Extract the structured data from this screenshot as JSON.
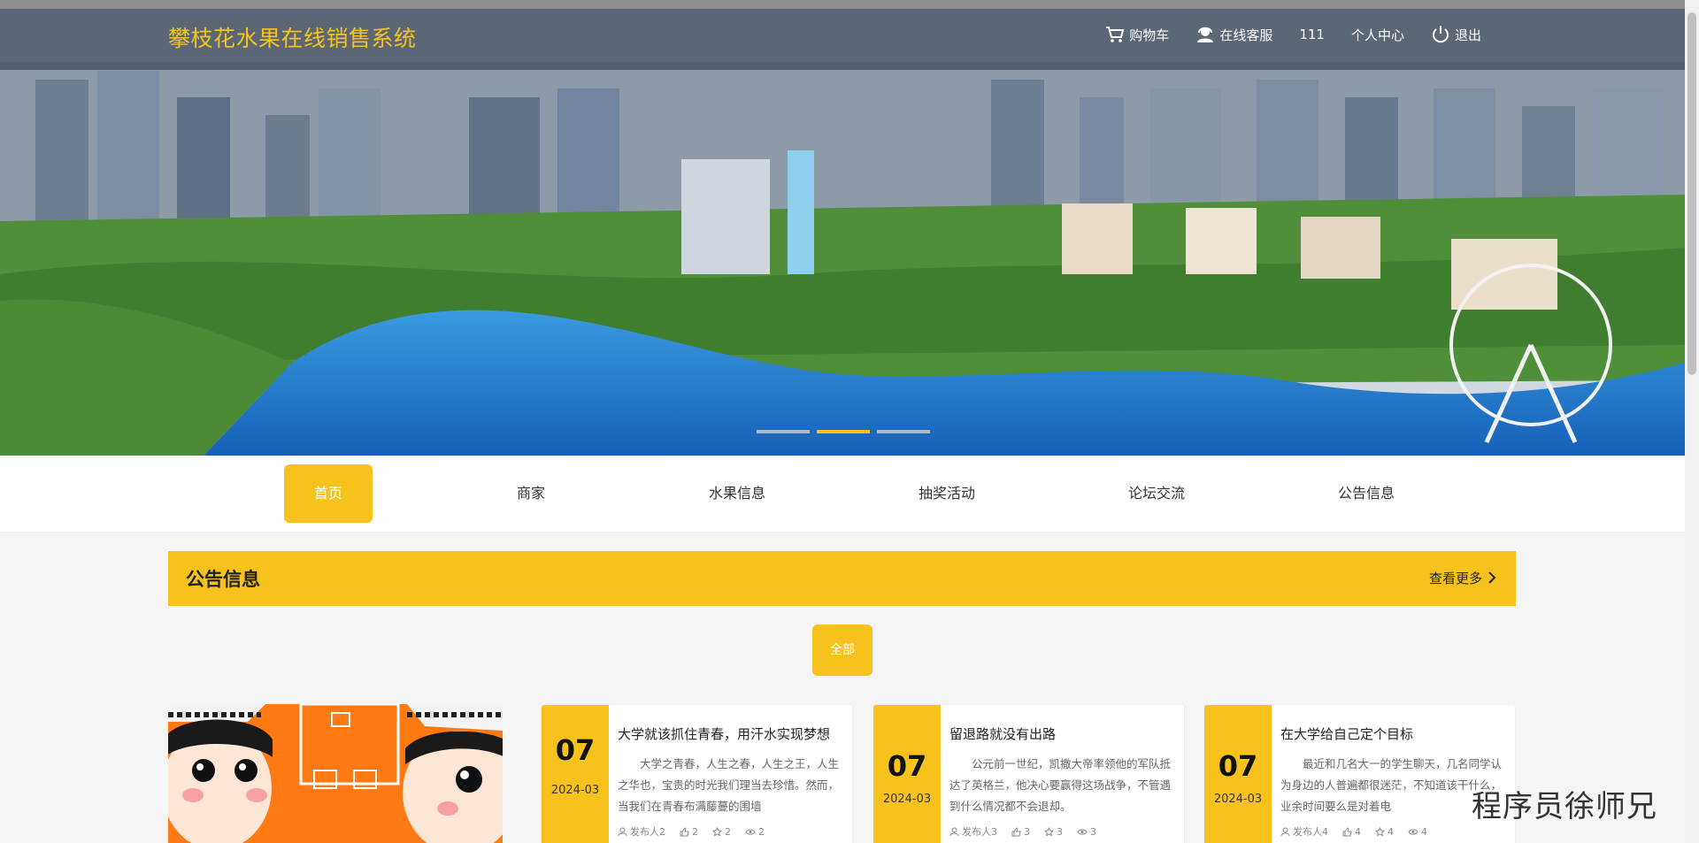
{
  "site": {
    "title": "攀枝花水果在线销售系统"
  },
  "header_nav": {
    "cart": "购物车",
    "service": "在线客服",
    "username": "111",
    "profile": "个人中心",
    "logout": "退出"
  },
  "main_nav": [
    "首页",
    "商家",
    "水果信息",
    "抽奖活动",
    "论坛交流",
    "公告信息"
  ],
  "section": {
    "title": "公告信息",
    "more": "查看更多"
  },
  "filter": {
    "all": "全部"
  },
  "cards": [
    {
      "day": "07",
      "year_month": "2024-03",
      "title": "大学就该抓住青春，用汗水实现梦想",
      "text": "大学之青春，人生之春，人生之王，人生之华也，宝贵的时光我们理当去珍惜。然而，当我们在青春布满藤蔓的围墙",
      "publisher": "发布人2",
      "likes": "2",
      "stars": "2",
      "views": "2"
    },
    {
      "day": "07",
      "year_month": "2024-03",
      "title": "留退路就没有出路",
      "text": "公元前一世纪，凯撒大帝率领他的军队抵达了英格兰，他决心要赢得这场战争，不管遇到什么情况都不会退却。",
      "publisher": "发布人3",
      "likes": "3",
      "stars": "3",
      "views": "3"
    },
    {
      "day": "07",
      "year_month": "2024-03",
      "title": "在大学给自己定个目标",
      "text": "最近和几名大一的学生聊天，几名同学认为身边的人普遍都很迷茫，不知道该干什么，业余时间要么是对着电",
      "publisher": "发布人4",
      "likes": "4",
      "stars": "4",
      "views": "4"
    }
  ],
  "watermark": "程序员徐师兄",
  "colors": {
    "accent": "#f6c21b",
    "header_overlay": "#3c4655"
  },
  "carousel": {
    "slides": 3,
    "active": 2
  }
}
